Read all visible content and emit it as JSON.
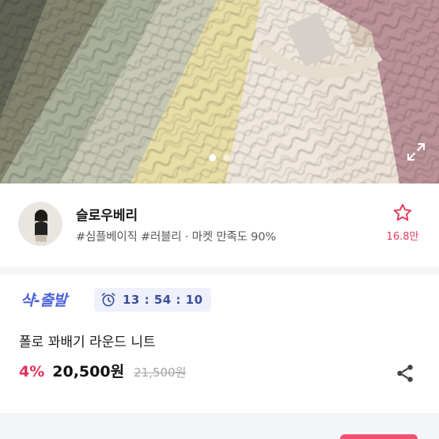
{
  "gallery": {
    "slides": [
      "slide-1",
      "slide-2"
    ],
    "active_index": 0,
    "expand_icon": "expand-icon",
    "sweater_colors": [
      "#5b5e4f",
      "#7e8069",
      "#a6ac96",
      "#c4c6b0",
      "#e8dca2",
      "#efe7dc",
      "#b98e95"
    ]
  },
  "shop": {
    "name": "슬로우베리",
    "tags": "#심플베이직 #러블리 · 마켓 만족도 90%",
    "favorite_icon": "star-outline-icon",
    "favorite_count": "16.8만",
    "accent_color": "#e23b5c"
  },
  "product": {
    "promo_label": "샥-출발",
    "promo_color": "#4b61d8",
    "timer_icon": "alarm-clock-icon",
    "timer": "13 : 54 : 10",
    "title": "폴로 꽈배기 라운드 니트",
    "discount": "4%",
    "price": "20,500원",
    "original_price": "21,500원",
    "share_icon": "share-icon"
  }
}
